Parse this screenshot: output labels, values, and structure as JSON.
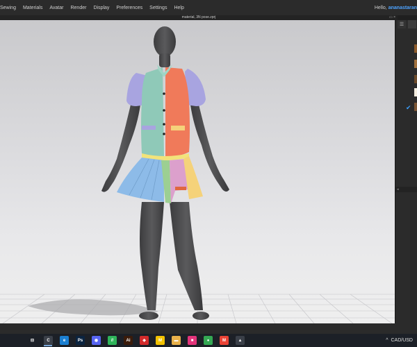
{
  "menubar": {
    "items": [
      "Sewing",
      "Materials",
      "Avatar",
      "Render",
      "Display",
      "Preferences",
      "Settings",
      "Help"
    ],
    "greeting": "Hello,",
    "username": "ananastaran"
  },
  "document": {
    "file_title": "material, 3N pose.zprj"
  },
  "right_panel": {
    "tab_list_icon": "list-icon",
    "swatch_colors": [
      "#8b5a2b",
      "#a0703c",
      "#6b4a2a",
      "#f4ede0",
      "#7a5535"
    ],
    "selected_check": "✔",
    "collapse_arrow": "◂"
  },
  "garment": {
    "colors": {
      "sleeve": "#a8a4e0",
      "vest_left": "#8fc9b8",
      "vest_right": "#f07a5a",
      "skirt_blue": "#8dbbe8",
      "skirt_green": "#9ccf92",
      "skirt_pink": "#dca0cc",
      "skirt_yellow": "#f5d27a",
      "waistband": "#f2e37a",
      "avatar": "#4b4b4d"
    }
  },
  "taskbar": {
    "apps": [
      {
        "name": "task-view-icon",
        "glyph": "⊟",
        "color": "#1c2027"
      },
      {
        "name": "clo-app-icon",
        "glyph": "C",
        "color": "#3a3f48",
        "active": true
      },
      {
        "name": "edge-icon",
        "glyph": "e",
        "color": "#1b7fd1"
      },
      {
        "name": "photoshop-icon",
        "glyph": "Ps",
        "color": "#0b2440"
      },
      {
        "name": "discord-icon",
        "glyph": "◉",
        "color": "#5865f2"
      },
      {
        "name": "sheets-app-icon",
        "glyph": "//",
        "color": "#2fb45a"
      },
      {
        "name": "illustrator-icon",
        "glyph": "Ai",
        "color": "#3a1b0a"
      },
      {
        "name": "acrobat-icon",
        "glyph": "◈",
        "color": "#d22b2b"
      },
      {
        "name": "miro-icon",
        "glyph": "M",
        "color": "#f2c200"
      },
      {
        "name": "file-explorer-icon",
        "glyph": "▬",
        "color": "#e8b14a"
      },
      {
        "name": "pink-app-icon",
        "glyph": "■",
        "color": "#e2347a"
      },
      {
        "name": "chrome-icon",
        "glyph": "●",
        "color": "#34a853"
      },
      {
        "name": "gmail-icon",
        "glyph": "M",
        "color": "#ea4335"
      },
      {
        "name": "photos-icon",
        "glyph": "▲",
        "color": "#3a3f48"
      }
    ],
    "tray_arrow": "^",
    "currency": "CAD/USD"
  }
}
